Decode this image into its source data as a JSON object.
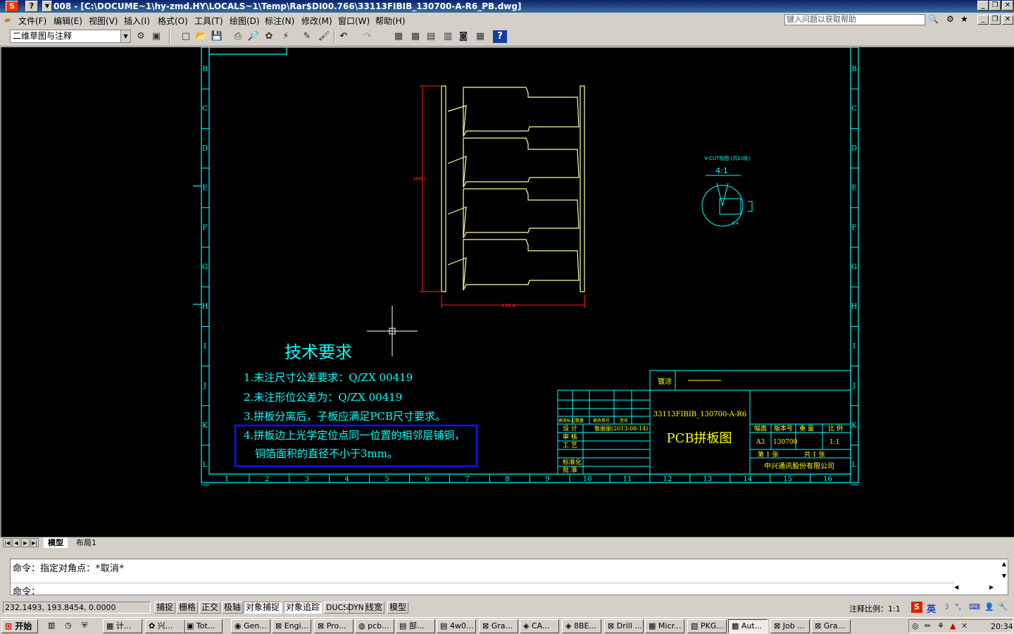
{
  "window": {
    "title": "008 - [C:\\DOCUME~1\\hy-zmd.HY\\LOCALS~1\\Temp\\Rar$DI00.766\\33113FIBIB_130700-A-R6_PB.dwg]",
    "app_icon": "S",
    "help_btn": "?"
  },
  "menu": [
    "文件(F)",
    "编辑(E)",
    "视图(V)",
    "插入(I)",
    "格式(O)",
    "工具(T)",
    "绘图(D)",
    "标注(N)",
    "修改(M)",
    "窗口(W)",
    "帮助(H)"
  ],
  "help_search": {
    "placeholder": "键入问题以获取帮助"
  },
  "toolbar": {
    "workspace": "二维草图与注释"
  },
  "drawing": {
    "rows": [
      "B",
      "C",
      "D",
      "E",
      "F",
      "G",
      "H",
      "I",
      "J",
      "K",
      "L"
    ],
    "cols": [
      "1",
      "2",
      "3",
      "4",
      "5",
      "6",
      "7",
      "8",
      "9",
      "10",
      "11",
      "12",
      "13",
      "14",
      "15",
      "16"
    ],
    "dim_vertical": "188.1",
    "dim_horizontal": "130.4",
    "vcut_title": "V-CUT视图 (共10处)",
    "vcut_scale": "4:1",
    "vcut_depth": "0.4",
    "tech_title": "技术要求",
    "tech_items": [
      "1.未注尺寸公差要求：Q/ZX 00419",
      "2.未注形位公差为：Q/ZX 00419",
      "3.拼板分离后，子板应满足PCB尺寸要求。",
      "4.拼板边上光学定位点同一位置的相邻层铺铜，",
      "铜箔面积的直径不小于3mm。"
    ],
    "tb_coating": "镀涂",
    "tb_part": "33113FIBIB_130700-A-R6",
    "tb_name": "PCB拼板图",
    "tb_hdr": [
      "更改标记",
      "数量",
      "更改单号",
      "签名"
    ],
    "tb_roles": [
      "设 计",
      "审 核",
      "工 艺",
      "标准化",
      "批 准"
    ],
    "tb_designer": "鲁丽丽(2013-08-14)",
    "tb_col_headers": [
      "幅面",
      "版本号",
      "重 量",
      "比 例"
    ],
    "tb_size": "A3",
    "tb_version": "130700",
    "tb_scale": "1:1",
    "tb_sheet": "第 1 张",
    "tb_sheets": "共 1 张",
    "tb_company": "中兴通讯股份有限公司"
  },
  "tabs": [
    "模型",
    "布局1"
  ],
  "command": {
    "history": "命令：指定对角点：*取消*",
    "prompt": "命令："
  },
  "status": {
    "coords": "232.1493, 193.8454, 0.0000",
    "buttons": [
      "捕捉",
      "栅格",
      "正交",
      "极轴",
      "对象捕捉",
      "对象追踪",
      "DUCS",
      "DYN",
      "线宽",
      "模型"
    ],
    "annotation_scale": "注释比例：1:1",
    "ime": "英"
  },
  "taskbar": {
    "start": "开始",
    "tasks": [
      "计...",
      "兴...",
      "Tot...",
      "Gen...",
      "Engi...",
      "Pro...",
      "pcb...",
      "部...",
      "4w0...",
      "Gra...",
      "CA...",
      "8BE...",
      "Drill ...",
      "Micr...",
      "PKG...",
      "Aut...",
      "Job ...",
      "Gra..."
    ],
    "clock": "20:34"
  },
  "colors": {
    "canvas": "#000000",
    "frame": "#00ffff",
    "geometry": "#ffff99",
    "dimension": "#ff2020",
    "highlight_box": "#1010ff",
    "title_text": "#ffff00"
  }
}
